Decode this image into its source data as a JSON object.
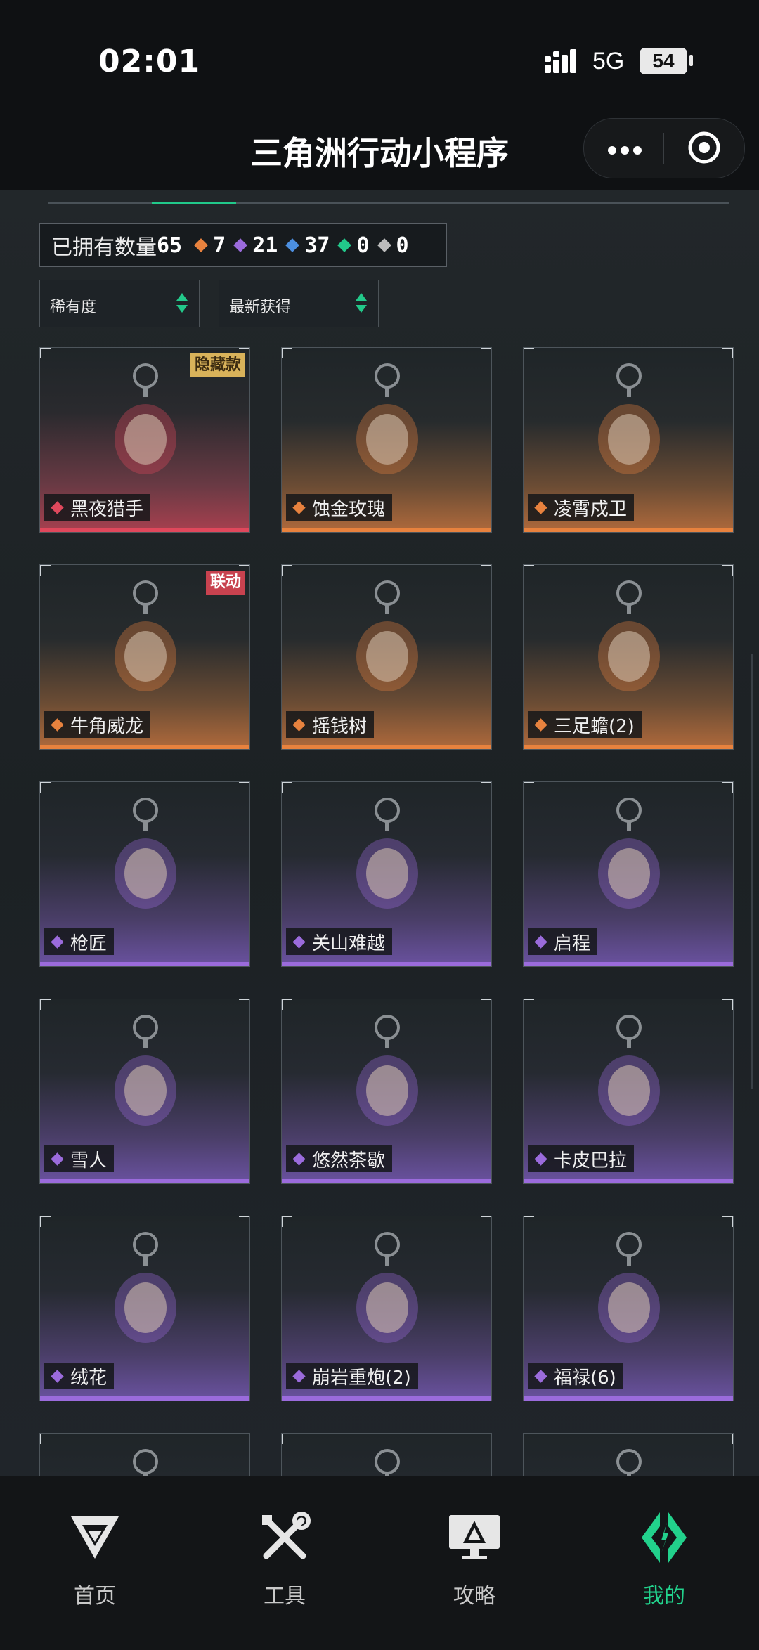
{
  "status": {
    "time": "02:01",
    "network": "5G",
    "battery": "54"
  },
  "header": {
    "title": "三角洲行动小程序"
  },
  "summary": {
    "owned_label": "已拥有数量",
    "owned_count": "65",
    "rarity_counts": [
      {
        "color": "#e8823e",
        "value": "7"
      },
      {
        "color": "#9b6bdc",
        "value": "21"
      },
      {
        "color": "#4c8fe0",
        "value": "37"
      },
      {
        "color": "#22c98a",
        "value": "0"
      },
      {
        "color": "#bdbdbd",
        "value": "0"
      }
    ]
  },
  "filters": {
    "sort_rarity": "稀有度",
    "sort_recent": "最新获得"
  },
  "items": [
    {
      "name": "黑夜猎手",
      "rarity": "red",
      "badge": "隐藏款"
    },
    {
      "name": "蚀金玫瑰",
      "rarity": "orange",
      "badge": ""
    },
    {
      "name": "凌霄戍卫",
      "rarity": "orange",
      "badge": ""
    },
    {
      "name": "牛角威龙",
      "rarity": "orange",
      "badge": "联动"
    },
    {
      "name": "摇钱树",
      "rarity": "orange",
      "badge": ""
    },
    {
      "name": "三足蟾(2)",
      "rarity": "orange",
      "badge": ""
    },
    {
      "name": "枪匠",
      "rarity": "purple",
      "badge": ""
    },
    {
      "name": "关山难越",
      "rarity": "purple",
      "badge": ""
    },
    {
      "name": "启程",
      "rarity": "purple",
      "badge": ""
    },
    {
      "name": "雪人",
      "rarity": "purple",
      "badge": ""
    },
    {
      "name": "悠然茶歇",
      "rarity": "purple",
      "badge": ""
    },
    {
      "name": "卡皮巴拉",
      "rarity": "purple",
      "badge": ""
    },
    {
      "name": "绒花",
      "rarity": "purple",
      "badge": ""
    },
    {
      "name": "崩岩重炮(2)",
      "rarity": "purple",
      "badge": ""
    },
    {
      "name": "福禄(6)",
      "rarity": "purple",
      "badge": ""
    }
  ],
  "tabs": [
    {
      "label": "首页",
      "icon": "delta-logo-icon",
      "active": false
    },
    {
      "label": "工具",
      "icon": "wrench-screwdriver-icon",
      "active": false
    },
    {
      "label": "攻略",
      "icon": "monitor-guide-icon",
      "active": false
    },
    {
      "label": "我的",
      "icon": "profile-logo-icon",
      "active": true
    }
  ],
  "colors": {
    "accent": "#22d18c",
    "red_rarity": "#e0485c",
    "orange_rarity": "#e8823e",
    "purple_rarity": "#9b6bdc",
    "hidden_badge_bg": "#d8b25a",
    "collab_badge_bg": "#c8424f"
  }
}
